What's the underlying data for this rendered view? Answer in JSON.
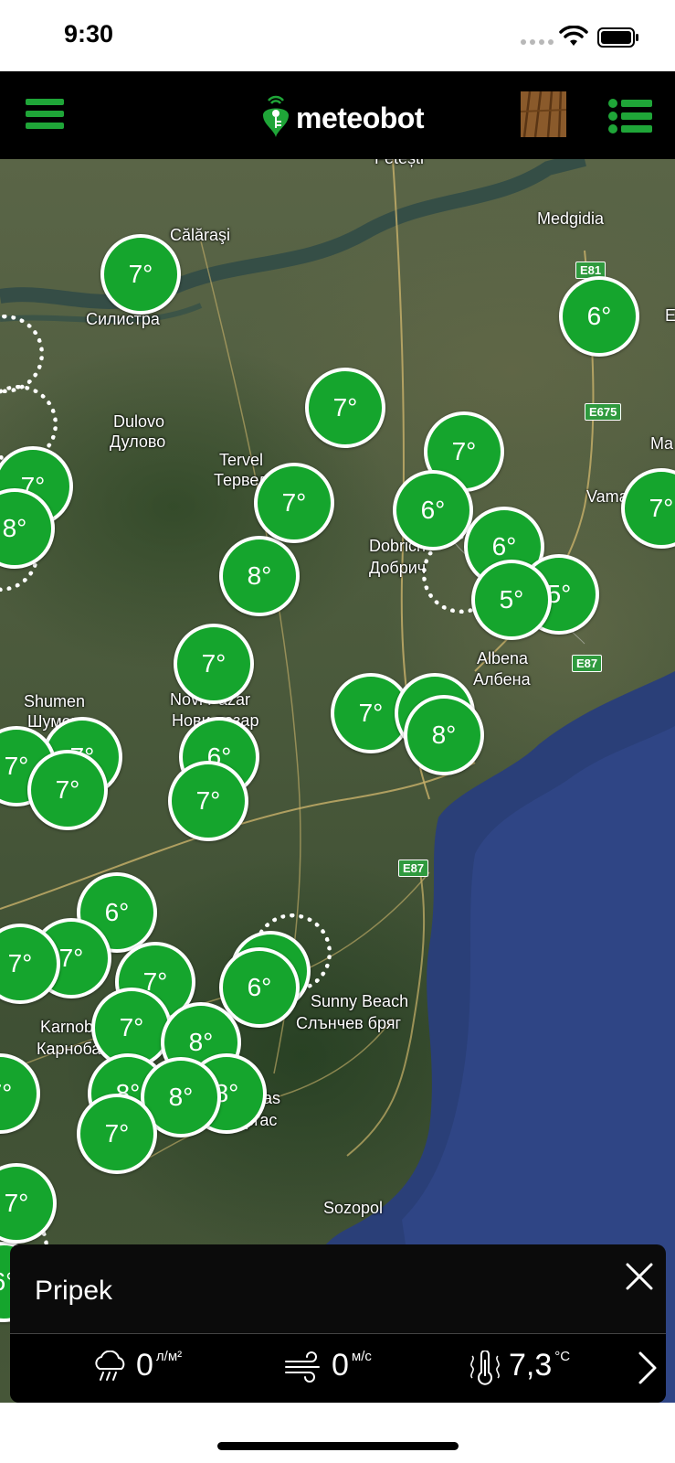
{
  "status": {
    "time": "9:30"
  },
  "header": {
    "logo_text": "meteobot",
    "colors": {
      "accent": "#1fa538",
      "bar": "#000000"
    }
  },
  "map": {
    "places": [
      {
        "name": "Călăraşi"
      },
      {
        "name": "Силистра"
      },
      {
        "name": "Medgidia"
      },
      {
        "name": "Dulovo"
      },
      {
        "name": "Дулово"
      },
      {
        "name": "Tervel"
      },
      {
        "name": "Тервел"
      },
      {
        "name": "Dobrich"
      },
      {
        "name": "Добрич"
      },
      {
        "name": "Vama"
      },
      {
        "name": "Ma"
      },
      {
        "name": "E"
      },
      {
        "name": "Albena"
      },
      {
        "name": "Албена"
      },
      {
        "name": "Shumen"
      },
      {
        "name": "Шумен"
      },
      {
        "name": "Novi Pazar"
      },
      {
        "name": "Нови пазар"
      },
      {
        "name": "Sunny Beach"
      },
      {
        "name": "Слънчев бряг"
      },
      {
        "name": "Karnobat"
      },
      {
        "name": "Карнобат"
      },
      {
        "name": "Burgas"
      },
      {
        "name": "Бургас"
      },
      {
        "name": "Sozopol"
      },
      {
        "name": "Fetești"
      }
    ],
    "roads": [
      "E81",
      "E675",
      "E87",
      "E87"
    ],
    "markers": [
      "7°",
      "6°",
      "7°",
      "7°",
      "7°",
      "6°",
      "6°",
      "5°",
      "5°",
      "8°",
      "7°",
      "7°",
      "8°",
      "7°",
      "7°",
      "8°",
      "8°",
      "7°",
      "7°",
      "7°",
      "6°",
      "7°",
      "6°",
      "7°",
      "7°",
      "7°",
      "6°",
      "6°",
      "7°",
      "8°",
      "8°",
      "8°",
      "8°",
      "7°",
      "7°",
      "6°",
      "7°"
    ]
  },
  "station_card": {
    "name": "Pripek",
    "rain_value": "0",
    "rain_unit": "л/м²",
    "wind_value": "0",
    "wind_unit": "м/с",
    "temp_value": "7,3",
    "temp_unit": "°C"
  }
}
